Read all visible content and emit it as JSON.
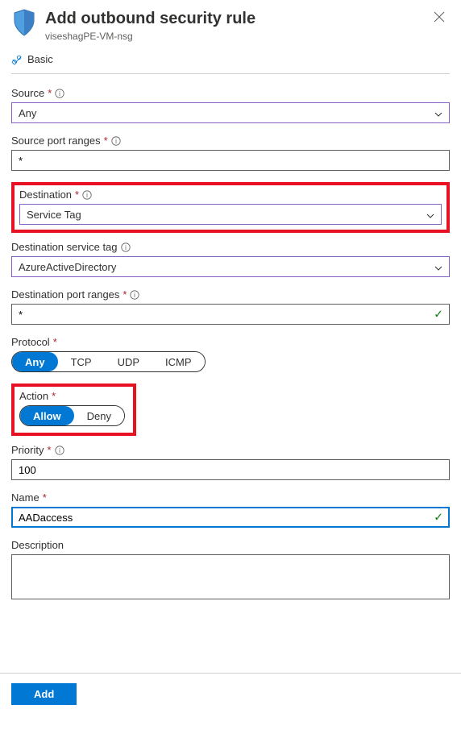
{
  "header": {
    "title": "Add outbound security rule",
    "subtitle": "viseshagPE-VM-nsg"
  },
  "basic_label": "Basic",
  "fields": {
    "source": {
      "label": "Source",
      "value": "Any"
    },
    "source_port_ranges": {
      "label": "Source port ranges",
      "value": "*"
    },
    "destination": {
      "label": "Destination",
      "value": "Service Tag"
    },
    "dest_service_tag": {
      "label": "Destination service tag",
      "value": "AzureActiveDirectory"
    },
    "dest_port_ranges": {
      "label": "Destination port ranges",
      "value": "*"
    },
    "protocol": {
      "label": "Protocol",
      "options": [
        "Any",
        "TCP",
        "UDP",
        "ICMP"
      ],
      "selected": "Any"
    },
    "action": {
      "label": "Action",
      "options": [
        "Allow",
        "Deny"
      ],
      "selected": "Allow"
    },
    "priority": {
      "label": "Priority",
      "value": "100"
    },
    "name": {
      "label": "Name",
      "value": "AADaccess"
    },
    "description": {
      "label": "Description",
      "value": ""
    }
  },
  "footer": {
    "add_label": "Add"
  }
}
